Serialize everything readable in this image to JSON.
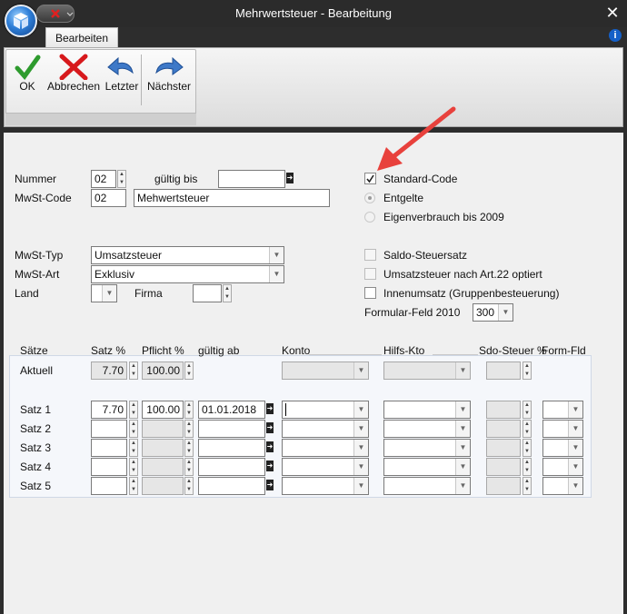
{
  "window": {
    "title": "Mehrwertsteuer - Bearbeitung",
    "close": "✕",
    "help": "i"
  },
  "ribbon": {
    "tab": "Bearbeiten",
    "buttons": [
      {
        "label": "OK",
        "icon": "checkmark-icon"
      },
      {
        "label": "Abbrechen",
        "icon": "cancel-x-icon"
      },
      {
        "label": "Letzter",
        "icon": "arrow-back-icon"
      },
      {
        "label": "Nächster",
        "icon": "arrow-forward-icon"
      }
    ]
  },
  "form": {
    "nummer": {
      "label": "Nummer",
      "value": "02"
    },
    "gueltig_bis": {
      "label": "gültig bis",
      "value": ""
    },
    "mwst_code": {
      "label": "MwSt-Code",
      "code": "02",
      "name": "Mehwertsteuer"
    },
    "mwst_typ": {
      "label": "MwSt-Typ",
      "value": "Umsatzsteuer"
    },
    "mwst_art": {
      "label": "MwSt-Art",
      "value": "Exklusiv"
    },
    "land": {
      "label": "Land",
      "value": ""
    },
    "firma": {
      "label": "Firma",
      "value": ""
    },
    "options": {
      "standard_code": {
        "label": "Standard-Code",
        "checked": true
      },
      "entgelte": {
        "label": "Entgelte",
        "selected": true
      },
      "eigenverbrauch": {
        "label": "Eigenverbrauch bis 2009",
        "selected": false
      },
      "saldo": {
        "label": "Saldo-Steuersatz",
        "checked": false
      },
      "art22": {
        "label": "Umsatzsteuer nach Art.22 optiert",
        "checked": false
      },
      "innenumsatz": {
        "label": "Innenumsatz (Gruppenbesteuerung)",
        "checked": false
      }
    },
    "formular_feld": {
      "label": "Formular-Feld 2010",
      "value": "300"
    }
  },
  "saetze": {
    "headers": {
      "saetze": "Sätze",
      "satz_pct": "Satz %",
      "pflicht_pct": "Pflicht %",
      "gueltig_ab": "gültig ab",
      "konto": "Konto",
      "hilfs_kto": "Hilfs-Kto",
      "sdo_steuer": "Sdo-Steuer %",
      "form_fld": "Form-Fld"
    },
    "aktuell": {
      "label": "Aktuell",
      "satz": "7.70",
      "pflicht": "100.00"
    },
    "rows": [
      {
        "label": "Satz 1",
        "satz": "7.70",
        "pflicht": "100.00",
        "gueltig_ab": "01.01.2018"
      },
      {
        "label": "Satz 2",
        "satz": "",
        "pflicht": "",
        "gueltig_ab": ""
      },
      {
        "label": "Satz 3",
        "satz": "",
        "pflicht": "",
        "gueltig_ab": ""
      },
      {
        "label": "Satz 4",
        "satz": "",
        "pflicht": "",
        "gueltig_ab": ""
      },
      {
        "label": "Satz 5",
        "satz": "",
        "pflicht": "",
        "gueltig_ab": ""
      }
    ]
  },
  "annotation": {
    "arrow_color": "#e8413c"
  }
}
